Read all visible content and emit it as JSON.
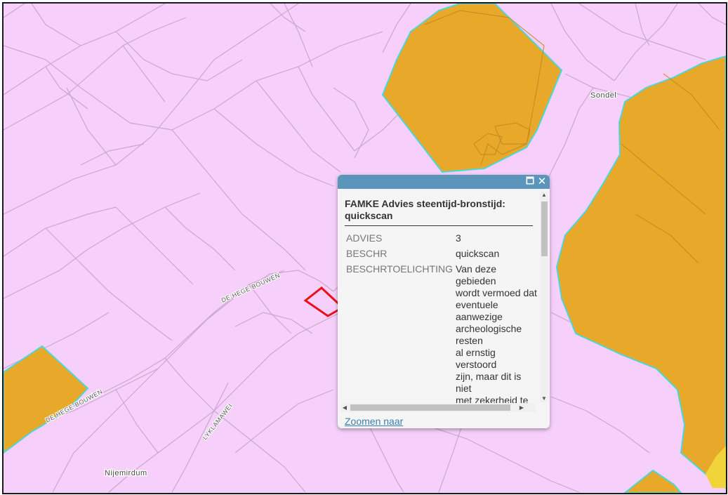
{
  "map": {
    "place_labels": [
      "Sondel",
      "Nijemirdum"
    ],
    "road_labels": [
      "DE HEGE BOUWEN",
      "DE HEGE BOUWEN",
      "LYKLAMAWEI"
    ],
    "colors": {
      "background": "#f6d0fb",
      "zone_fill": "#e8a82a",
      "zone_outline": "#4dd7d7",
      "selection_outline": "#e8101a",
      "roads": "#c9a8cc",
      "yellow_patch": "#f0d43a"
    }
  },
  "popup": {
    "title": "FAMKE Advies steentijd-bronstijd: quickscan",
    "attributes": [
      {
        "name": "ADVIES",
        "value": "3"
      },
      {
        "name": "BESCHR",
        "value": "quickscan"
      },
      {
        "name": "BESCHRTOELICHTING",
        "value": "Van deze gebieden\nwordt vermoed dat\neventuele aanwezige\narcheologische resten\nal ernstig verstoord\nzijn, maar dit is niet\nmet zekerheid te\nzeggen. De provincie\nbeveelt daarom aan\nom bij ingrepen van\nmeer dan 5000m²\neen inventariserend"
      }
    ],
    "zoom_link": "Zoomen naar",
    "maximize_icon": "maximize-icon",
    "close_icon": "close-icon",
    "header_color": "#5b95bb"
  }
}
